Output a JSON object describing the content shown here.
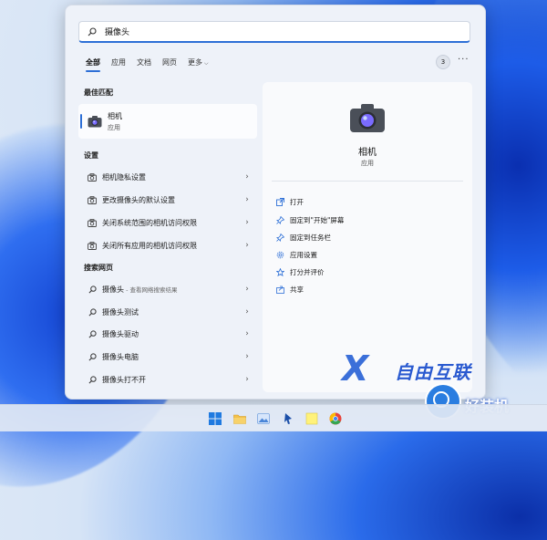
{
  "search": {
    "value": "摄像头",
    "placeholder": ""
  },
  "tabs": [
    {
      "label": "全部",
      "active": true
    },
    {
      "label": "应用"
    },
    {
      "label": "文档"
    },
    {
      "label": "网页"
    },
    {
      "label": "更多"
    }
  ],
  "result_count": "3",
  "more_menu": "···",
  "best_match": {
    "heading": "最佳匹配",
    "name": "相机",
    "type": "应用"
  },
  "settings": {
    "heading": "设置",
    "items": [
      {
        "label": "相机隐私设置"
      },
      {
        "label": "更改摄像头的默认设置"
      },
      {
        "label": "关闭系统范围的相机访问权限"
      },
      {
        "label": "关闭所有应用的相机访问权限"
      }
    ]
  },
  "web": {
    "heading": "搜索网页",
    "items": [
      {
        "label": "摄像头",
        "sub": " - 查看网络搜索结果"
      },
      {
        "label": "摄像头测试"
      },
      {
        "label": "摄像头驱动"
      },
      {
        "label": "摄像头电脑"
      },
      {
        "label": "摄像头打不开"
      }
    ]
  },
  "preview": {
    "name": "相机",
    "type": "应用",
    "actions": [
      {
        "label": "打开",
        "icon": "open-icon"
      },
      {
        "label": "固定到\"开始\"屏幕",
        "icon": "pin-icon"
      },
      {
        "label": "固定到任务栏",
        "icon": "pin-icon"
      },
      {
        "label": "应用设置",
        "icon": "gear-icon"
      },
      {
        "label": "打分并评价",
        "icon": "star-icon"
      },
      {
        "label": "共享",
        "icon": "share-icon"
      }
    ]
  },
  "watermark": {
    "mark": "X",
    "text": "自由互联",
    "corner_text": "好装机"
  },
  "colors": {
    "accent": "#2d6fd6",
    "camera_lens": "#7a6bff"
  },
  "taskbar_icons": [
    "windows-start-icon",
    "file-explorer-icon",
    "photos-icon",
    "pin-icon",
    "notes-icon",
    "chrome-icon"
  ]
}
